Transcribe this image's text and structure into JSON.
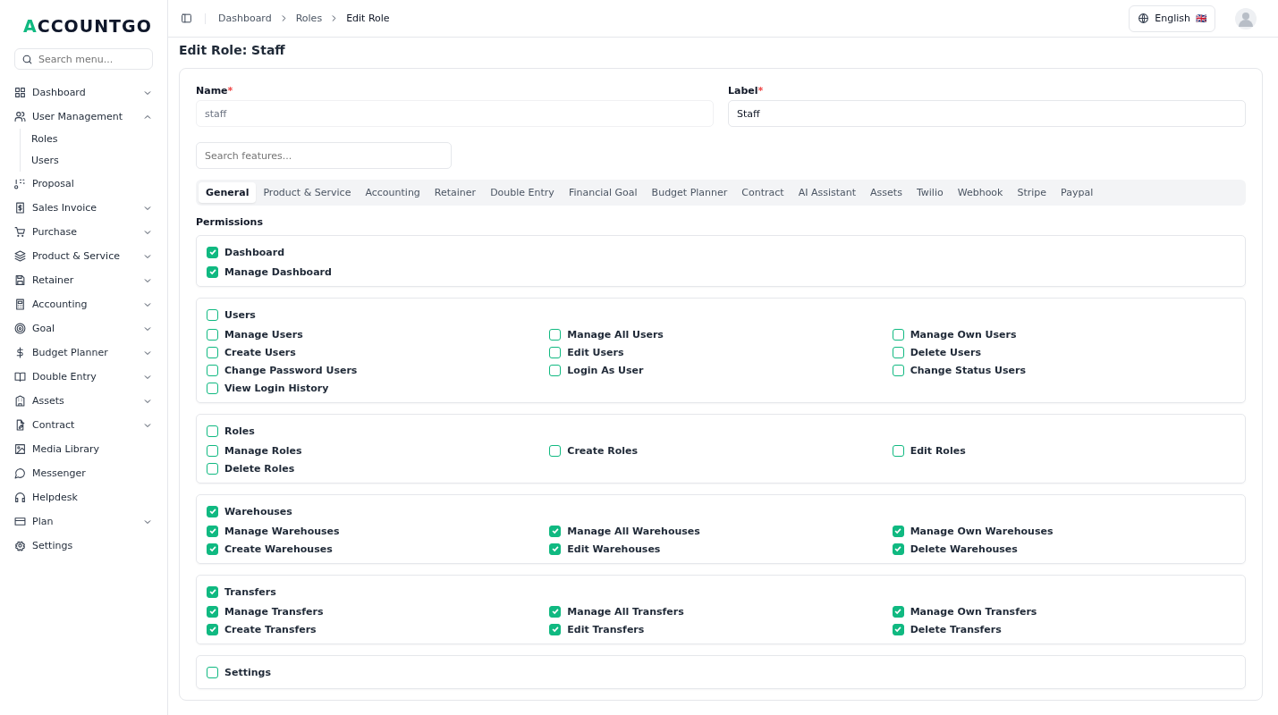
{
  "logo": {
    "accent": "A",
    "rest": "CCOUNTGO"
  },
  "sidebar": {
    "search_placeholder": "Search menu...",
    "items": [
      {
        "label": "Dashboard",
        "expanded": false
      },
      {
        "label": "User Management",
        "expanded": true,
        "children": [
          {
            "label": "Roles"
          },
          {
            "label": "Users"
          }
        ]
      },
      {
        "label": "Proposal"
      },
      {
        "label": "Sales Invoice",
        "expanded": false
      },
      {
        "label": "Purchase",
        "expanded": false
      },
      {
        "label": "Product & Service",
        "expanded": false
      },
      {
        "label": "Retainer",
        "expanded": false
      },
      {
        "label": "Accounting",
        "expanded": false
      },
      {
        "label": "Goal",
        "expanded": false
      },
      {
        "label": "Budget Planner",
        "expanded": false
      },
      {
        "label": "Double Entry",
        "expanded": false
      },
      {
        "label": "Assets",
        "expanded": false
      },
      {
        "label": "Contract",
        "expanded": false
      },
      {
        "label": "Media Library"
      },
      {
        "label": "Messenger"
      },
      {
        "label": "Helpdesk"
      },
      {
        "label": "Plan",
        "expanded": false
      },
      {
        "label": "Settings"
      }
    ]
  },
  "breadcrumb": [
    "Dashboard",
    "Roles",
    "Edit Role"
  ],
  "language": {
    "label": "English",
    "flag": "🇬🇧"
  },
  "page_title": "Edit Role: Staff",
  "form": {
    "name": {
      "label": "Name",
      "required_mark": "*",
      "value": "staff",
      "disabled": true
    },
    "label": {
      "label": "Label",
      "required_mark": "*",
      "value": "Staff",
      "disabled": false
    },
    "feature_search_placeholder": "Search features..."
  },
  "tabs": [
    {
      "label": "General",
      "selected": true
    },
    {
      "label": "Product & Service",
      "selected": false
    },
    {
      "label": "Accounting",
      "selected": false
    },
    {
      "label": "Retainer",
      "selected": false
    },
    {
      "label": "Double Entry",
      "selected": false
    },
    {
      "label": "Financial Goal",
      "selected": false
    },
    {
      "label": "Budget Planner",
      "selected": false
    },
    {
      "label": "Contract",
      "selected": false
    },
    {
      "label": "AI Assistant",
      "selected": false
    },
    {
      "label": "Assets",
      "selected": false
    },
    {
      "label": "Twilio",
      "selected": false
    },
    {
      "label": "Webhook",
      "selected": false
    },
    {
      "label": "Stripe",
      "selected": false
    },
    {
      "label": "Paypal",
      "selected": false
    }
  ],
  "permissions_heading": "Permissions",
  "groups": [
    {
      "label": "Dashboard",
      "checked": true,
      "items": [
        {
          "label": "Manage Dashboard",
          "checked": true
        }
      ]
    },
    {
      "label": "Users",
      "checked": false,
      "items": [
        {
          "label": "Manage Users",
          "checked": false
        },
        {
          "label": "Manage All Users",
          "checked": false
        },
        {
          "label": "Manage Own Users",
          "checked": false
        },
        {
          "label": "Create Users",
          "checked": false
        },
        {
          "label": "Edit Users",
          "checked": false
        },
        {
          "label": "Delete Users",
          "checked": false
        },
        {
          "label": "Change Password Users",
          "checked": false
        },
        {
          "label": "Login As User",
          "checked": false
        },
        {
          "label": "Change Status Users",
          "checked": false
        },
        {
          "label": "View Login History",
          "checked": false
        }
      ]
    },
    {
      "label": "Roles",
      "checked": false,
      "items": [
        {
          "label": "Manage Roles",
          "checked": false
        },
        {
          "label": "Create Roles",
          "checked": false
        },
        {
          "label": "Edit Roles",
          "checked": false
        },
        {
          "label": "Delete Roles",
          "checked": false
        }
      ]
    },
    {
      "label": "Warehouses",
      "checked": true,
      "items": [
        {
          "label": "Manage Warehouses",
          "checked": true
        },
        {
          "label": "Manage All Warehouses",
          "checked": true
        },
        {
          "label": "Manage Own Warehouses",
          "checked": true
        },
        {
          "label": "Create Warehouses",
          "checked": true
        },
        {
          "label": "Edit Warehouses",
          "checked": true
        },
        {
          "label": "Delete Warehouses",
          "checked": true
        }
      ]
    },
    {
      "label": "Transfers",
      "checked": true,
      "items": [
        {
          "label": "Manage Transfers",
          "checked": true
        },
        {
          "label": "Manage All Transfers",
          "checked": true
        },
        {
          "label": "Manage Own Transfers",
          "checked": true
        },
        {
          "label": "Create Transfers",
          "checked": true
        },
        {
          "label": "Edit Transfers",
          "checked": true
        },
        {
          "label": "Delete Transfers",
          "checked": true
        }
      ]
    },
    {
      "label": "Settings",
      "checked": false
    }
  ]
}
